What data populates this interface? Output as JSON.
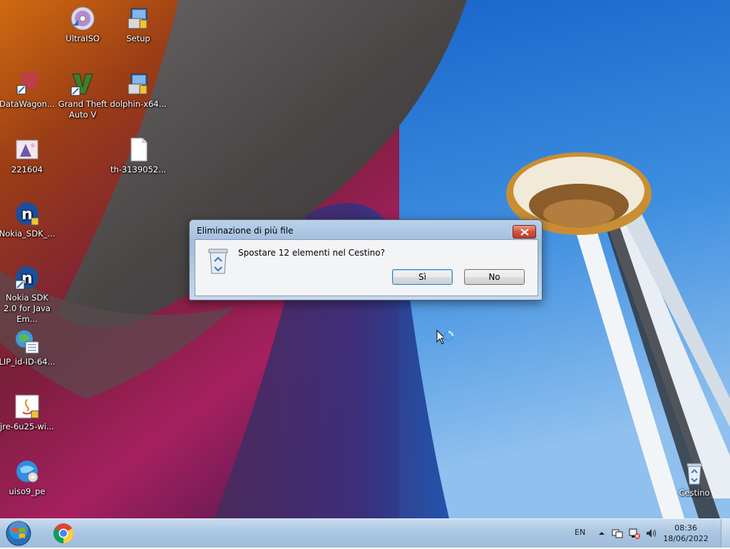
{
  "desktop": {
    "icons": [
      {
        "label": "UltraISO",
        "icon": "disc-icon"
      },
      {
        "label": "Setup",
        "icon": "installer-icon"
      },
      {
        "label": "DataWagon...",
        "icon": "app-icon"
      },
      {
        "label": "Grand Theft Auto V",
        "icon": "gta-v-icon"
      },
      {
        "label": "dolphin-x64...",
        "icon": "installer-icon"
      },
      {
        "label": "221604",
        "icon": "image-file-icon"
      },
      {
        "label": "th-3139052...",
        "icon": "blank-file-icon"
      },
      {
        "label": "Nokia_SDK_...",
        "icon": "nokia-n-icon"
      },
      {
        "label": "Nokia SDK 2.0 for Java Em...",
        "icon": "nokia-n-icon"
      },
      {
        "label": "LIP_id-ID-64...",
        "icon": "language-pack-icon"
      },
      {
        "label": "jre-6u25-wi...",
        "icon": "java-icon"
      },
      {
        "label": "uiso9_pe",
        "icon": "globe-disc-icon"
      },
      {
        "label": "Cestino",
        "icon": "recycle-bin-icon"
      }
    ]
  },
  "dialog": {
    "title": "Eliminazione di più file",
    "message": "Spostare 12 elementi nel Cestino?",
    "yes_label": "Sì",
    "no_label": "No",
    "icon": "recycle-bin-icon"
  },
  "taskbar": {
    "pinned": [
      "chrome-icon"
    ],
    "language": "EN",
    "tray_icons": [
      "show-hidden-icons-icon",
      "action-center-icon",
      "network-disconnected-icon",
      "volume-icon"
    ],
    "time": "08:36",
    "date": "18/06/2022"
  },
  "colors": {
    "sky": "#1d6fd0",
    "taskbar": "#aac6e2",
    "close_button": "#d6523b"
  }
}
